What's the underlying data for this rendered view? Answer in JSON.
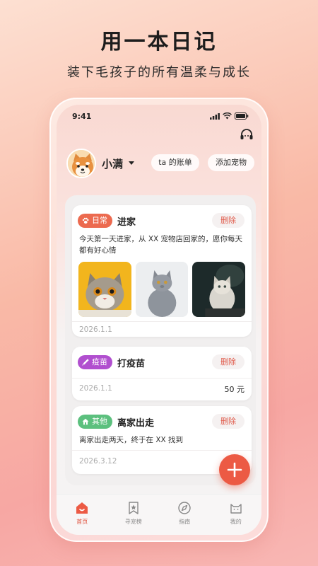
{
  "promo": {
    "headline": "用一本日记",
    "subline": "装下毛孩子的所有温柔与成长"
  },
  "status_bar": {
    "time": "9:41"
  },
  "header": {
    "support_icon": "headset-icon",
    "pet_name": "小满",
    "bill_button": "ta 的账单",
    "add_pet_button": "添加宠物"
  },
  "colors": {
    "accent": "#ec5a44",
    "tag_daily": "#ec6a4f",
    "tag_vaccine": "#b14fcf",
    "tag_other": "#5cc07e"
  },
  "entries": [
    {
      "tag": "日常",
      "tag_icon": "paw-icon",
      "title": "进家",
      "delete_label": "删除",
      "description": "今天第一天进家，从 XX 宠物店回家的，愿你每天都有好心情",
      "photos": [
        "orange-cat-photo",
        "grey-cat-photo",
        "white-cat-photo"
      ],
      "date": "2026.1.1"
    },
    {
      "tag": "疫苗",
      "tag_icon": "syringe-icon",
      "title": "打疫苗",
      "delete_label": "删除",
      "date": "2026.1.1",
      "amount": "50 元"
    },
    {
      "tag": "其他",
      "tag_icon": "home-icon",
      "title": "离家出走",
      "delete_label": "删除",
      "description": "离家出走两天，终于在 XX 找到",
      "date": "2026.3.12"
    }
  ],
  "fab": {
    "icon": "plus-icon"
  },
  "tabbar": [
    {
      "label": "首页",
      "icon": "home-icon",
      "active": true
    },
    {
      "label": "寻宠榜",
      "icon": "bookmark-star-icon",
      "active": false
    },
    {
      "label": "指南",
      "icon": "compass-icon",
      "active": false
    },
    {
      "label": "我的",
      "icon": "cat-face-icon",
      "active": false
    }
  ]
}
